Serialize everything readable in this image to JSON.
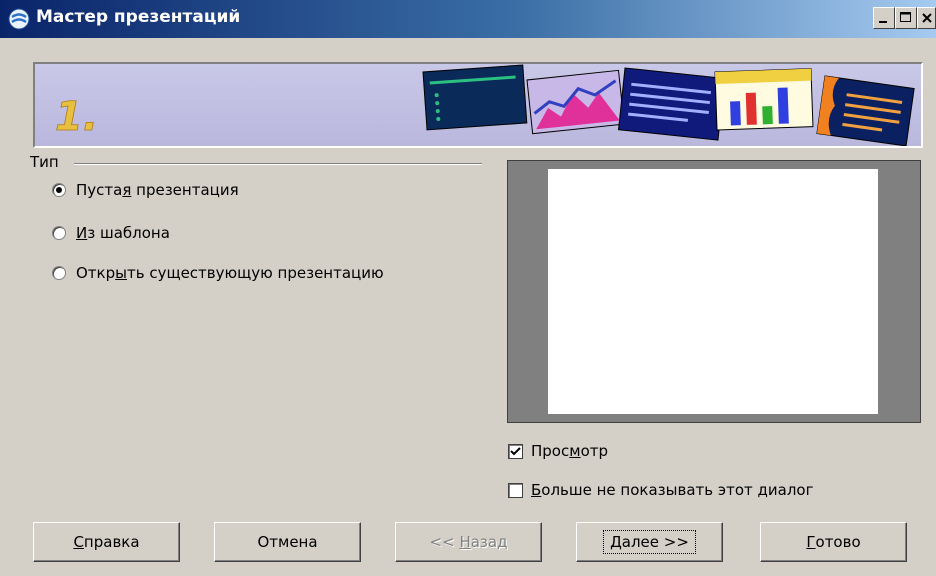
{
  "window": {
    "title": "Мастер презентаций",
    "icon": "app-icon",
    "controls": [
      "minimize-icon",
      "maximize-icon",
      "close-icon"
    ]
  },
  "banner": {
    "step": "1."
  },
  "type_group": {
    "label": "Тип",
    "options": [
      {
        "before": "Пуста",
        "mnemonic": "я",
        "after": " презентация",
        "checked": true
      },
      {
        "before": "",
        "mnemonic": "И",
        "after": "з шаблона",
        "checked": false
      },
      {
        "before": "Откр",
        "mnemonic": "ы",
        "after": "ть существующую презентацию",
        "checked": false
      }
    ]
  },
  "preview_checkbox": {
    "before": "Прос",
    "mnemonic": "м",
    "after": "отр",
    "checked": true
  },
  "dont_show_checkbox": {
    "before": "",
    "mnemonic": "Б",
    "after": "ольше не показывать этот диалог",
    "checked": false
  },
  "buttons": {
    "help": {
      "before": "",
      "mnemonic": "С",
      "after": "правка"
    },
    "cancel": {
      "label": "Отмена"
    },
    "back": {
      "before": "<< ",
      "mnemonic": "Н",
      "after": "азад"
    },
    "next": {
      "before": "",
      "mnemonic": "Д",
      "after": "алее >>"
    },
    "finish": {
      "before": "",
      "mnemonic": "Г",
      "after": "отово"
    }
  }
}
